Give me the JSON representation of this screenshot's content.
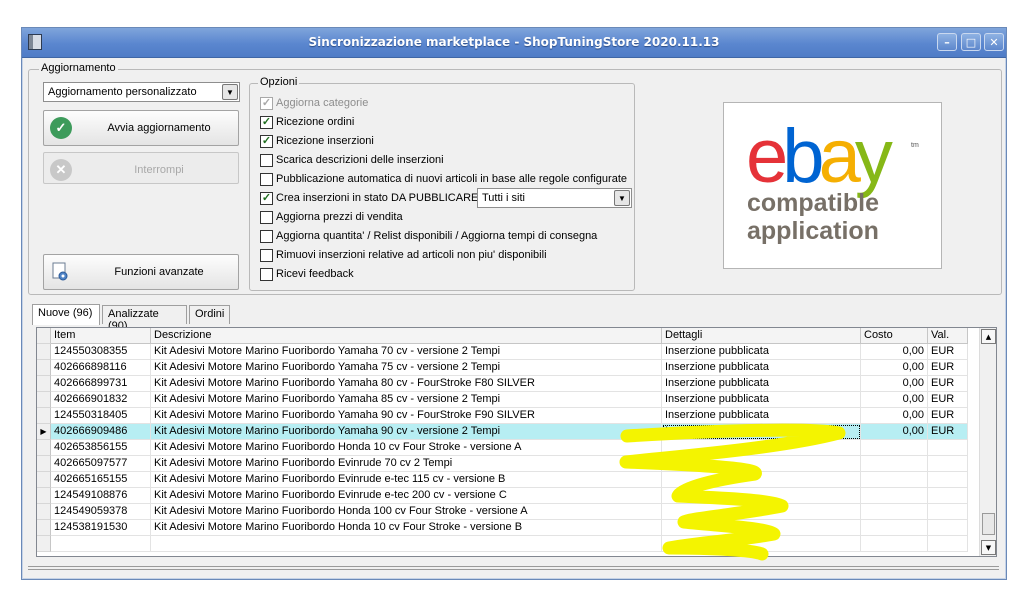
{
  "window": {
    "title": "Sincronizzazione marketplace - ShopTuningStore 2020.11.13",
    "buttons": {
      "minimize": "–",
      "maximize": "□",
      "close": "✕"
    }
  },
  "aggiornamento": {
    "group_label": "Aggiornamento",
    "mode_selected": "Aggiornamento personalizzato",
    "start_label": "Avvia aggiornamento",
    "stop_label": "Interrompi",
    "advanced_label": "Funzioni avanzate"
  },
  "opzioni": {
    "group_label": "Opzioni",
    "items": [
      {
        "label": "Aggiorna categorie",
        "checked": true,
        "enabled": false
      },
      {
        "label": "Ricezione ordini",
        "checked": true,
        "enabled": true
      },
      {
        "label": "Ricezione inserzioni",
        "checked": true,
        "enabled": true
      },
      {
        "label": "Scarica descrizioni delle inserzioni",
        "checked": false,
        "enabled": true
      },
      {
        "label": "Pubblicazione automatica di nuovi articoli in base alle regole configurate",
        "checked": false,
        "enabled": true
      },
      {
        "label": "Crea inserzioni in stato DA PUBBLICARE",
        "checked": true,
        "enabled": true
      },
      {
        "label": "Aggiorna prezzi di vendita",
        "checked": false,
        "enabled": true
      },
      {
        "label": "Aggiorna quantita' / Relist disponibili / Aggiorna tempi di consegna",
        "checked": false,
        "enabled": true
      },
      {
        "label": "Rimuovi inserzioni relative ad articoli non piu' disponibili",
        "checked": false,
        "enabled": true
      },
      {
        "label": "Ricevi feedback",
        "checked": false,
        "enabled": true
      }
    ],
    "sites_selected": "Tutti i siti"
  },
  "logo": {
    "letters": [
      "e",
      "b",
      "a",
      "y"
    ],
    "colors": [
      "#e53238",
      "#0064d2",
      "#f5af02",
      "#86b817"
    ],
    "tm": "tm",
    "line1": "compatible",
    "line2": "application"
  },
  "tabs": [
    "Nuove (96)",
    "Analizzate (90)",
    "Ordini"
  ],
  "table": {
    "columns": [
      "Item",
      "Descrizione",
      "Dettagli",
      "Costo",
      "Val."
    ],
    "rows": [
      [
        "124550308355",
        "Kit Adesivi Motore Marino Fuoribordo Yamaha 70 cv - versione 2 Tempi",
        "Inserzione pubblicata",
        "0,00",
        "EUR"
      ],
      [
        "402666898116",
        "Kit Adesivi Motore Marino Fuoribordo Yamaha 75 cv - versione 2 Tempi",
        "Inserzione pubblicata",
        "0,00",
        "EUR"
      ],
      [
        "402666899731",
        "Kit Adesivi Motore Marino Fuoribordo Yamaha 80 cv - FourStroke F80 SILVER",
        "Inserzione pubblicata",
        "0,00",
        "EUR"
      ],
      [
        "402666901832",
        "Kit Adesivi Motore Marino Fuoribordo Yamaha 85 cv - versione 2 Tempi",
        "Inserzione pubblicata",
        "0,00",
        "EUR"
      ],
      [
        "124550318405",
        "Kit Adesivi Motore Marino Fuoribordo Yamaha 90 cv - FourStroke F90 SILVER",
        "Inserzione pubblicata",
        "0,00",
        "EUR"
      ],
      [
        "402666909486",
        "Kit Adesivi Motore Marino Fuoribordo Yamaha 90 cv - versione 2 Tempi",
        "Inserzione pubblicata",
        "0,00",
        "EUR"
      ],
      [
        "402653856155",
        "Kit Adesivi Motore Marino Fuoribordo Honda 10 cv Four Stroke - versione A",
        "",
        "",
        ""
      ],
      [
        "402665097577",
        "Kit Adesivi Motore Marino Fuoribordo Evinrude 70 cv 2 Tempi",
        "",
        "",
        ""
      ],
      [
        "402665165155",
        "Kit Adesivi Motore Marino Fuoribordo Evinrude e-tec 115 cv - versione B",
        "",
        "",
        ""
      ],
      [
        "124549108876",
        "Kit Adesivi Motore Marino Fuoribordo Evinrude e-tec 200 cv - versione C",
        "",
        "",
        ""
      ],
      [
        "124549059378",
        "Kit Adesivi Motore Marino Fuoribordo Honda 100 cv Four Stroke - versione A",
        "",
        "",
        ""
      ],
      [
        "124538191530",
        "Kit Adesivi Motore Marino Fuoribordo Honda 10 cv Four Stroke - versione B",
        "",
        "",
        ""
      ],
      [
        "",
        "",
        "",
        "",
        ""
      ]
    ],
    "selected_row": 5,
    "selected_marker": "▶"
  },
  "scrollbar": {
    "up": "▲",
    "down": "▼"
  },
  "annotation": {
    "color": "#f4f400"
  }
}
